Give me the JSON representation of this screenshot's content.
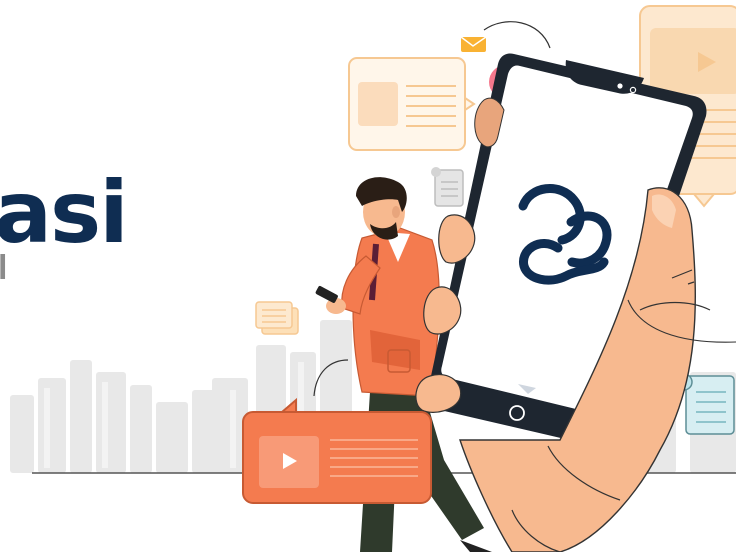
{
  "brand": {
    "wordmark": "asi",
    "tagline": "l"
  },
  "colors": {
    "navy": "#0f2d52",
    "orange": "#f47b4f",
    "orange_dark": "#e2643a",
    "skin": "#f7b98f",
    "peach_card": "#fde8cf",
    "peach_card_border": "#f6c892",
    "city_gray": "#e6e6e6",
    "phone_body": "#1e2630",
    "hair": "#2a1e16",
    "pants": "#2f3a2c",
    "teal_scroll": "#bfe4ea"
  },
  "icons": [
    "envelope-icon",
    "chat-bubble-icon",
    "document-icon",
    "play-icon",
    "cloud-logo-icon",
    "scroll-icon",
    "notes-stack-icon",
    "home-button-icon"
  ]
}
